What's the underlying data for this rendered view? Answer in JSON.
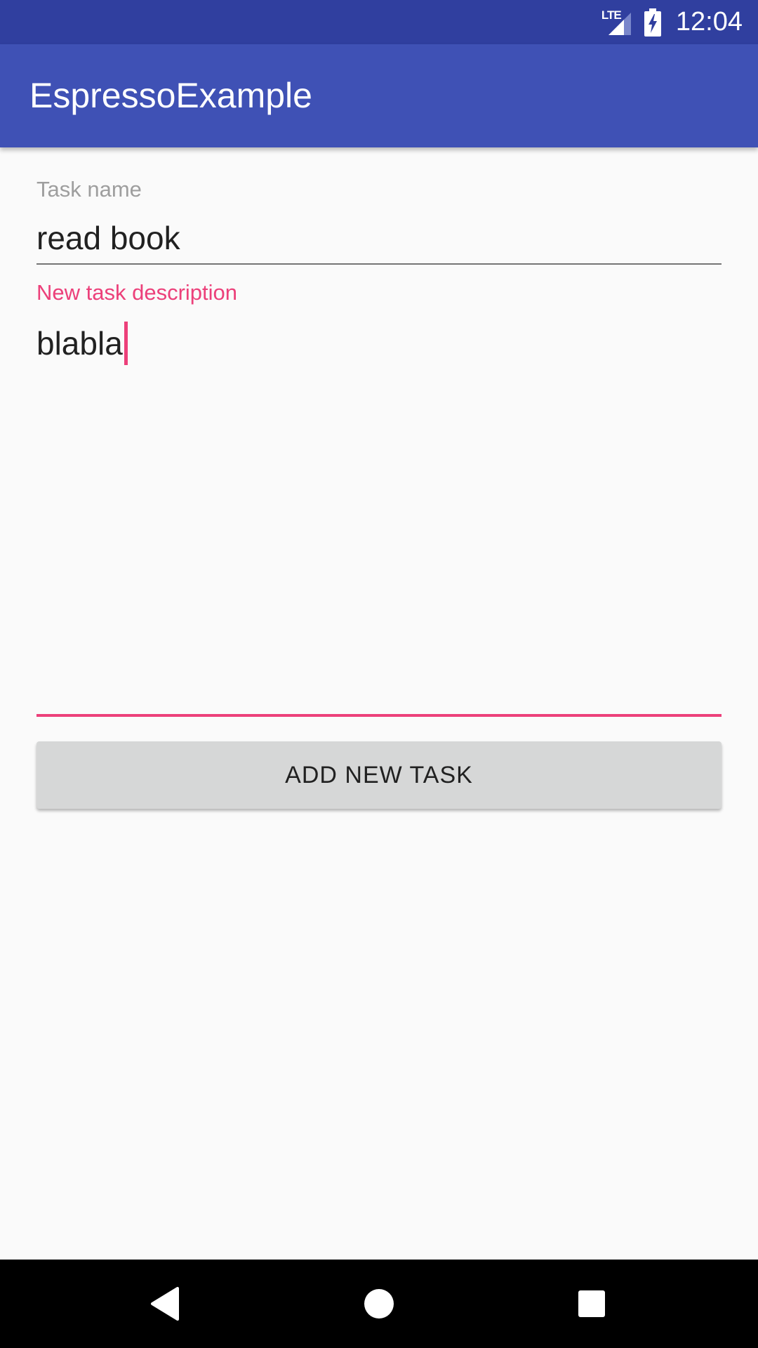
{
  "status_bar": {
    "network_label": "LTE",
    "time": "12:04",
    "icons": [
      "lte-signal-icon",
      "battery-charging-icon"
    ]
  },
  "app_bar": {
    "title": "EspressoExample"
  },
  "form": {
    "task_name": {
      "label": "Task name",
      "value": "read book"
    },
    "task_description": {
      "label": "New task description",
      "value": "blabla"
    },
    "add_button_label": "ADD NEW TASK"
  },
  "nav_bar": {
    "icons": [
      "back-icon",
      "home-icon",
      "recent-apps-icon"
    ]
  },
  "colors": {
    "status_bar": "#303f9f",
    "primary": "#3f51b5",
    "accent": "#ec407a",
    "background": "#fafafa",
    "button": "#d6d7d7"
  }
}
